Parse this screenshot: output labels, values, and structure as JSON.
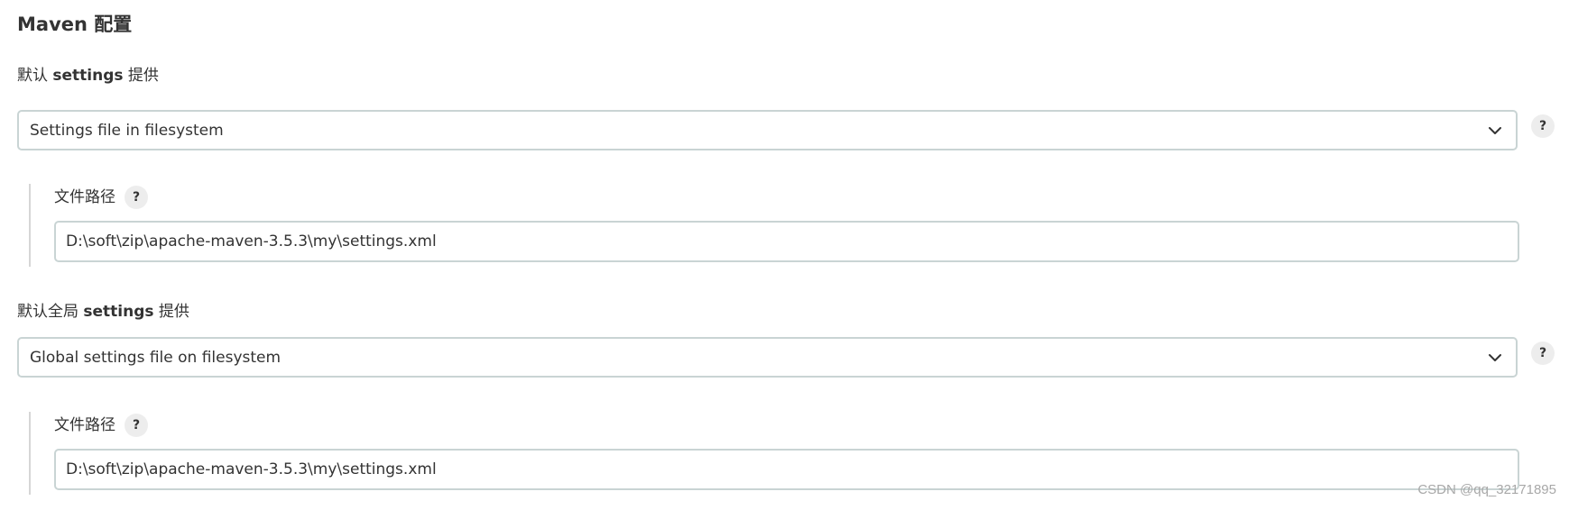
{
  "section": {
    "title": "Maven 配置"
  },
  "settings": {
    "label_prefix": "默认 ",
    "label_keyword": "settings",
    "label_suffix": " 提供",
    "selected": "Settings file in filesystem",
    "help": "?",
    "file_path": {
      "label": "文件路径",
      "help": "?",
      "value": "D:\\soft\\zip\\apache-maven-3.5.3\\my\\settings.xml"
    }
  },
  "global_settings": {
    "label_prefix": "默认全局 ",
    "label_keyword": "settings",
    "label_suffix": " 提供",
    "selected": "Global settings file on filesystem",
    "help": "?",
    "file_path": {
      "label": "文件路径",
      "help": "?",
      "value": "D:\\soft\\zip\\apache-maven-3.5.3\\my\\settings.xml"
    }
  },
  "watermark": "CSDN @qq_32171895",
  "icons": {
    "dropdown": "chevron-down-icon",
    "help": "help-icon"
  }
}
